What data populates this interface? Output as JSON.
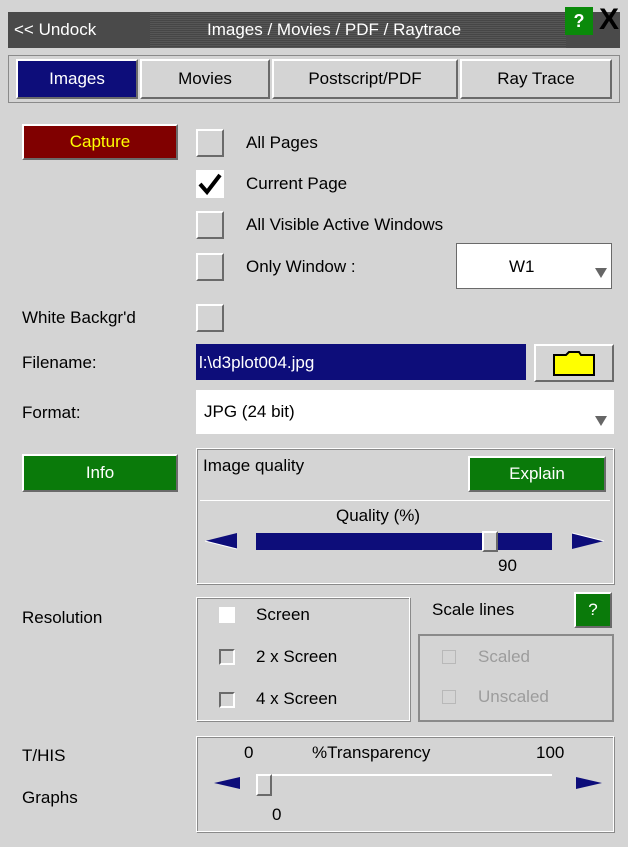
{
  "title_bar": {
    "undock_label": "<< Undock",
    "title": "Images / Movies / PDF / Raytrace",
    "help_label": "?",
    "close_label": "X"
  },
  "tabs": [
    {
      "label": "Images",
      "active": true
    },
    {
      "label": "Movies",
      "active": false
    },
    {
      "label": "Postscript/PDF",
      "active": false
    },
    {
      "label": "Ray Trace",
      "active": false
    }
  ],
  "capture": {
    "button_label": "Capture",
    "options": [
      {
        "label": "All Pages",
        "checked": false
      },
      {
        "label": "Current Page",
        "checked": true
      },
      {
        "label": "All Visible Active Windows",
        "checked": false
      },
      {
        "label": "Only Window :",
        "checked": false
      }
    ],
    "window_select_value": "W1"
  },
  "white_background": {
    "label": "White Backgr'd",
    "checked": false
  },
  "filename": {
    "label": "Filename:",
    "value": "l:\\d3plot004.jpg"
  },
  "format": {
    "label": "Format:",
    "value": "JPG (24 bit)"
  },
  "info_button_label": "Info",
  "image_quality": {
    "label": "Image quality",
    "explain_label": "Explain",
    "slider_label": "Quality (%)",
    "value": 90,
    "value_text": "90"
  },
  "resolution": {
    "label": "Resolution",
    "options": [
      {
        "label": "Screen",
        "selected": true
      },
      {
        "label": "2 x Screen",
        "selected": false
      },
      {
        "label": "4 x Screen",
        "selected": false
      }
    ]
  },
  "scale_lines": {
    "label": "Scale lines",
    "help_label": "?",
    "options": [
      {
        "label": "Scaled",
        "enabled": false
      },
      {
        "label": "Unscaled",
        "enabled": false
      }
    ]
  },
  "transparency": {
    "label_line1": "T/HIS",
    "label_line2": "Graphs",
    "min_text": "0",
    "max_text": "100",
    "slider_label": "%Transparency",
    "value": 0,
    "value_text": "0"
  },
  "colors": {
    "accent_blue": "#0d0d7a",
    "capture_red": "#800000",
    "capture_text": "#ffff00",
    "green": "#0a7a0a",
    "folder_yellow": "#ffff00"
  }
}
